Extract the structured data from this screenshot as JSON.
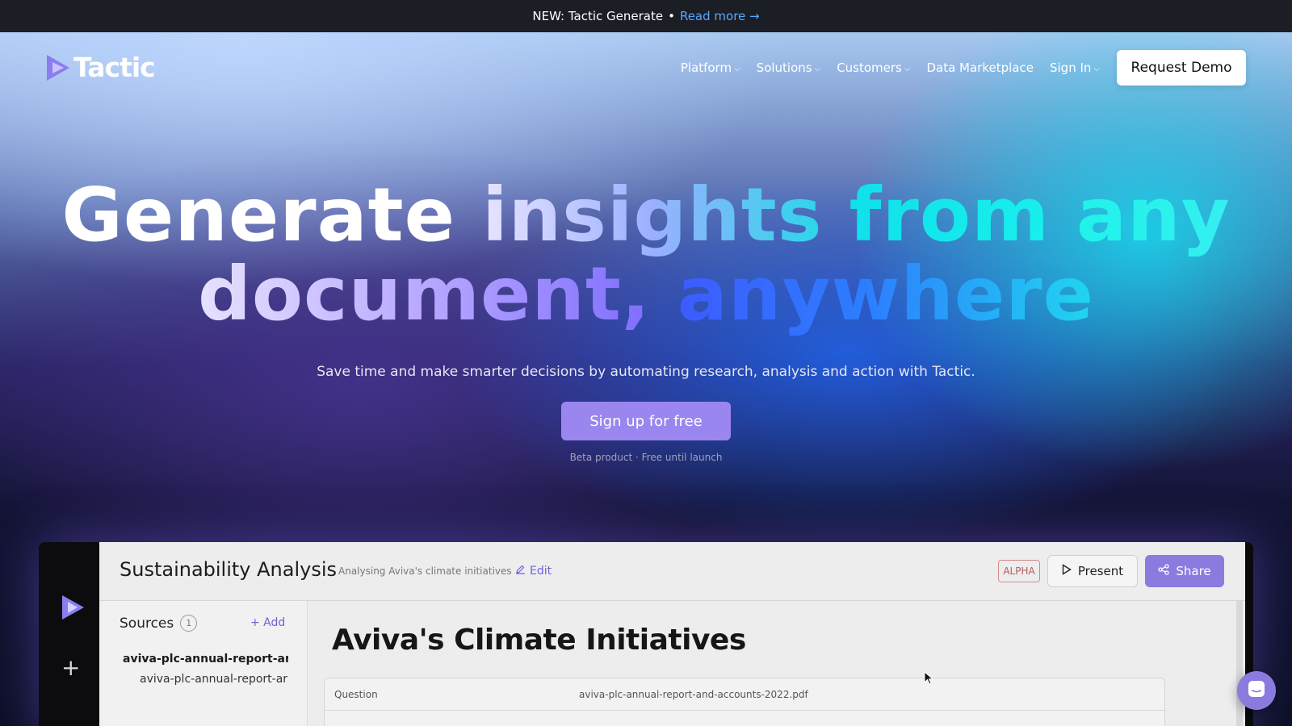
{
  "announcement": {
    "prefix": "NEW: Tactic Generate",
    "separator": "•",
    "link": "Read more →"
  },
  "brand": {
    "name": "Tactic"
  },
  "nav": {
    "items": [
      {
        "label": "Platform",
        "dropdown": true
      },
      {
        "label": "Solutions",
        "dropdown": true
      },
      {
        "label": "Customers",
        "dropdown": true
      },
      {
        "label": "Data Marketplace",
        "dropdown": false
      },
      {
        "label": "Sign In",
        "dropdown": true
      }
    ],
    "cta": "Request Demo"
  },
  "hero": {
    "headline": {
      "w1": "Generate",
      "w2": "insights",
      "w3": "from",
      "w4": "any",
      "w5": "document,",
      "w6": "anywhere"
    },
    "subtitle": "Save time and make smarter decisions by automating research, analysis and action with Tactic.",
    "cta": "Sign up for free",
    "note": "Beta product · Free until launch"
  },
  "app_preview": {
    "title": "Sustainability Analysis",
    "description": "Analysing Aviva's climate initiatives",
    "edit_label": "Edit",
    "badge": "ALPHA",
    "present_label": "Present",
    "share_label": "Share",
    "sources": {
      "label": "Sources",
      "count": "1",
      "add_label": "+ Add",
      "files": [
        "aviva-plc-annual-report-and",
        "aviva-plc-annual-report-ar"
      ]
    },
    "document": {
      "title": "Aviva's Climate Initiatives",
      "table_header": {
        "question": "Question",
        "file": "aviva-plc-annual-report-and-accounts-2022.pdf"
      }
    }
  },
  "colors": {
    "accent": "#9a86ee",
    "link": "#5aa7ff",
    "share": "#8b7bdf"
  },
  "icons": {
    "logo": "tactic-play-logo-icon",
    "chevron": "chevron-down-icon",
    "edit": "pencil-icon",
    "present": "play-icon",
    "share": "share-icon",
    "add": "plus-icon",
    "chat": "chat-icon"
  }
}
